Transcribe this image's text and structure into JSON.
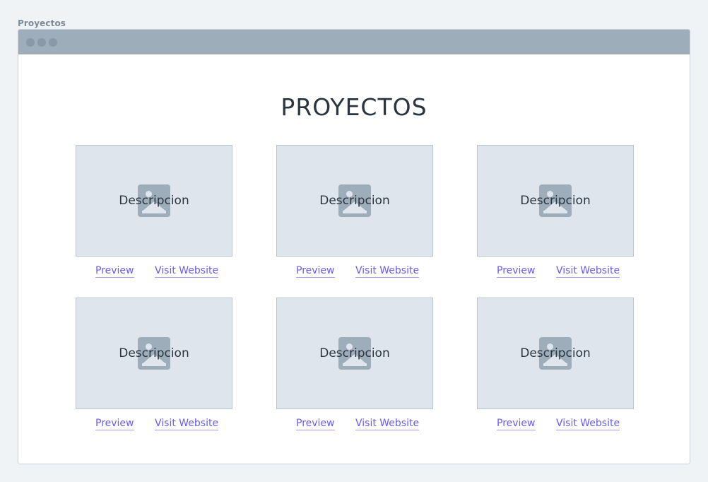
{
  "frame": {
    "label": "Proyectos"
  },
  "page": {
    "title": "PROYECTOS"
  },
  "projects": [
    {
      "description": "Descripcion",
      "preview_label": "Preview",
      "visit_label": "Visit Website",
      "thumbnail_icon": "image-placeholder-icon"
    },
    {
      "description": "Descripcion",
      "preview_label": "Preview",
      "visit_label": "Visit Website",
      "thumbnail_icon": "image-placeholder-icon"
    },
    {
      "description": "Descripcion",
      "preview_label": "Preview",
      "visit_label": "Visit Website",
      "thumbnail_icon": "image-placeholder-icon"
    },
    {
      "description": "Descripcion",
      "preview_label": "Preview",
      "visit_label": "Visit Website",
      "thumbnail_icon": "image-placeholder-icon"
    },
    {
      "description": "Descripcion",
      "preview_label": "Preview",
      "visit_label": "Visit Website",
      "thumbnail_icon": "image-placeholder-icon"
    },
    {
      "description": "Descripcion",
      "preview_label": "Preview",
      "visit_label": "Visit Website",
      "thumbnail_icon": "image-placeholder-icon"
    }
  ],
  "colors": {
    "link": "#6a5df0",
    "titlebar": "#9eadba",
    "thumbnail_bg": "#dee5ed",
    "text": "#2a3540"
  }
}
